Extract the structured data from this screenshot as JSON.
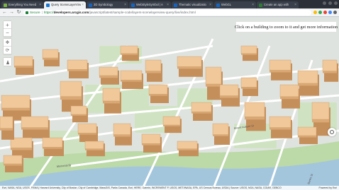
{
  "browser": {
    "tabs": [
      {
        "label": "Everything You Need",
        "favicon_color": "#7cb342",
        "active": false
      },
      {
        "label": "Query SceneLayerView",
        "favicon_color": "#1976d2",
        "active": true
      },
      {
        "label": "3D Symbology",
        "favicon_color": "#1565c0",
        "active": false
      },
      {
        "label": "WebStyleSymbol | A",
        "favicon_color": "#1565c0",
        "active": false
      },
      {
        "label": "Thematic visualizatio",
        "favicon_color": "#1565c0",
        "active": false
      },
      {
        "label": "WebGL",
        "favicon_color": "#1565c0",
        "active": false
      },
      {
        "label": "Create an app with",
        "favicon_color": "#2e7d32",
        "active": false
      }
    ],
    "close_glyph": "×",
    "nav": {
      "back": "←",
      "forward": "→",
      "reload": "↻"
    },
    "address": {
      "secure_label": "Secure",
      "separator": "|",
      "scheme": "https://",
      "host": "developers.arcgis.com",
      "path": "/javascript/latest/sample-code/layers-scenelayerview-query/live/index.html"
    },
    "extension_colors": [
      "#fbbc04",
      "#34a853",
      "#ea4335",
      "#4285f4",
      "#5f6368"
    ]
  },
  "map": {
    "widgets": {
      "zoom_in": "+",
      "zoom_out": "−",
      "pan_glyph": "✥",
      "rotate_glyph": "⟳",
      "home_glyph": "⌂"
    },
    "info_text": "Click on a building to zoom to it and get more information",
    "attribution": "Esri, NASA, NGA, USGS, FEMA | Harvard University, City of Boston, City of Cambridge, MassGIS, Parks Canada, Esri, HERE, Garmin, INCREMENT P, USGS, METI/NASA, EPA, US Census Bureau, USDA | Source: USGS, NGA, NASA, CGIAR, GEBCO",
    "powered_by": "Powered by Esri",
    "street_labels": [
      "Memorial Dr",
      "Mount Auburn St",
      "Banks St"
    ],
    "colors": {
      "ground": "#dfe3df",
      "park": "#cfe3c2",
      "water": "#a3c6dd",
      "road": "#ffffff",
      "building_top": "#f0c89a",
      "building_side": "#d9a874",
      "building_dark": "#c58f5b"
    }
  }
}
